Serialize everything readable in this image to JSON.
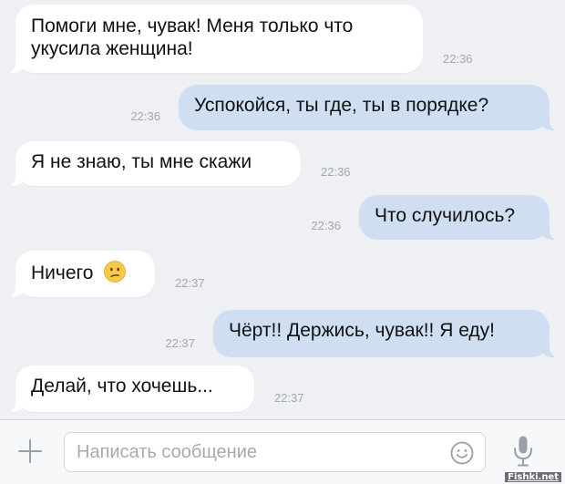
{
  "messages": [
    {
      "text_line1": "Помоги мне, чувак! Меня только что",
      "text_line2": "укусила женщина!",
      "time": "22:36"
    },
    {
      "text": "Успокойся, ты где, ты в порядке?",
      "time": "22:36"
    },
    {
      "text": "Я не знаю, ты мне скажи",
      "time": "22:36"
    },
    {
      "text": "Что случилось?",
      "time": "22:36"
    },
    {
      "text": "Ничего",
      "emoji": "confused-face",
      "time": "22:37"
    },
    {
      "text": "Чёрт!! Держись, чувак!! Я еду!",
      "time": "22:37"
    },
    {
      "text": "Делай, что хочешь...",
      "time": "22:37"
    }
  ],
  "composer": {
    "placeholder": "Написать сообщение",
    "attach_icon": "plus-icon",
    "emoji_icon": "smile-icon",
    "voice_icon": "microphone-icon"
  },
  "watermark": "Fishki.net",
  "colors": {
    "background": "#eef0f3",
    "incoming_bubble": "#ffffff",
    "outgoing_bubble": "#cfdff1",
    "accent": "#5181b8"
  }
}
